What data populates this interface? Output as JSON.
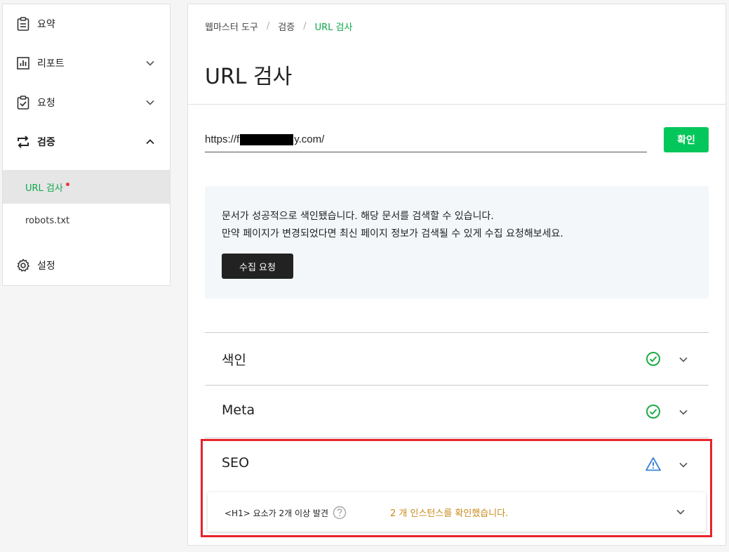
{
  "sidebar": {
    "items": [
      {
        "label": "요약",
        "icon": "clipboard-icon"
      },
      {
        "label": "리포트",
        "icon": "chart-icon"
      },
      {
        "label": "요청",
        "icon": "check-clipboard-icon"
      },
      {
        "label": "검증",
        "icon": "swap-arrows-icon"
      },
      {
        "label": "설정",
        "icon": "gear-icon"
      }
    ],
    "subitems": [
      {
        "label": "URL 검사"
      },
      {
        "label": "robots.txt"
      }
    ]
  },
  "breadcrumb": {
    "items": [
      "웹마스터 도구",
      "검증",
      "URL 검사"
    ],
    "separator": "/"
  },
  "page": {
    "title": "URL 검사"
  },
  "url_check": {
    "value_prefix": "https://f",
    "value_suffix": "y.com/",
    "confirm_label": "확인"
  },
  "notice": {
    "line1": "문서가 성공적으로 색인됐습니다. 해당 문서를 검색할 수 있습니다.",
    "line2": "만약 페이지가 변경되었다면 최신 페이지 정보가 검색될 수 있게 수집 요청해보세요.",
    "button_label": "수집 요청"
  },
  "sections": [
    {
      "title": "색인",
      "status": "ok"
    },
    {
      "title": "Meta",
      "status": "ok"
    },
    {
      "title": "SEO",
      "status": "warning"
    }
  ],
  "seo_detail": {
    "label": "<H1> 요소가 2개 이상 발견",
    "message": "2 개 인스턴스를 확인했습니다."
  },
  "colors": {
    "accent_green": "#03c75a",
    "ok_green": "#1fab47",
    "warning_blue": "#3b82d6",
    "highlight_red": "#e8232b",
    "message_orange": "#c8891a"
  }
}
